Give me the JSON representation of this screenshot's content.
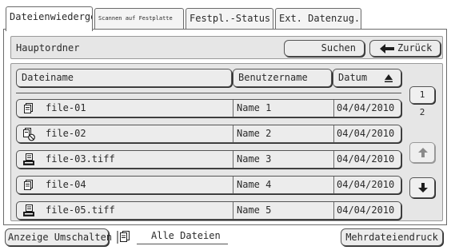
{
  "tabs": [
    {
      "label": "Dateienwiederge.",
      "active": true
    },
    {
      "label": "Scannen auf Festplatte",
      "active": false
    },
    {
      "label": "Festpl.-Status",
      "active": false
    },
    {
      "label": "Ext. Datenzug.",
      "active": false
    }
  ],
  "header": {
    "folder": "Hauptordner",
    "search_label": "Suchen",
    "back_label": "Zurück"
  },
  "columns": {
    "name": "Dateiname",
    "user": "Benutzername",
    "date": "Datum"
  },
  "files": [
    {
      "icon": "document-stack-icon",
      "name": "file-01",
      "user": "Name 1",
      "date": "04/04/2010"
    },
    {
      "icon": "document-stack-cancel-icon",
      "name": "file-02",
      "user": "Name 2",
      "date": "04/04/2010"
    },
    {
      "icon": "scan-document-icon",
      "name": "file-03.tiff",
      "user": "Name 3",
      "date": "04/04/2010"
    },
    {
      "icon": "document-stack-icon",
      "name": "file-04",
      "user": "Name 4",
      "date": "04/04/2010"
    },
    {
      "icon": "scan-document-icon",
      "name": "file-05.tiff",
      "user": "Name 5",
      "date": "04/04/2010"
    }
  ],
  "pager": {
    "current": "1",
    "total": "2"
  },
  "bottom": {
    "toggle_label": "Anzeige Umschalten",
    "filter_label": "Alle Dateien",
    "multi_print_label": "Mehrdateiendruck"
  }
}
